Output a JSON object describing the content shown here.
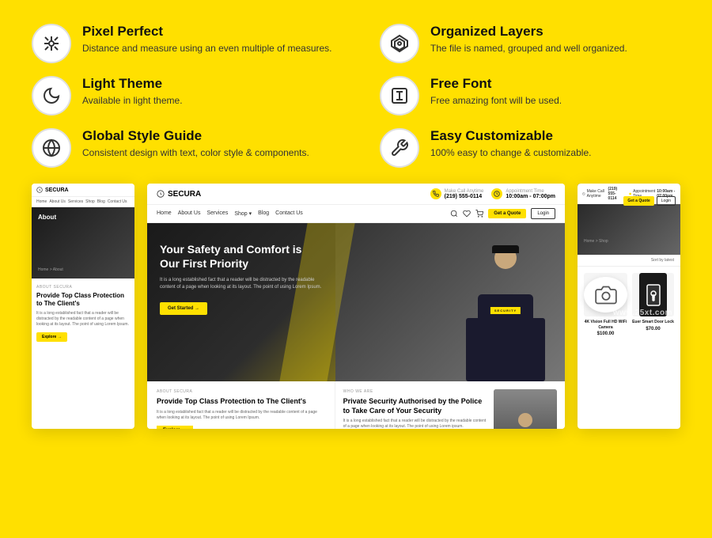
{
  "features": [
    {
      "id": "pixel-perfect",
      "title": "Pixel Perfect",
      "description": "Distance and measure using an even multiple of measures.",
      "icon": "⊕"
    },
    {
      "id": "organized-layers",
      "title": "Organized Layers",
      "description": "The file is named, grouped and well organized.",
      "icon": "◈"
    },
    {
      "id": "light-theme",
      "title": "Light Theme",
      "description": "Available in light theme.",
      "icon": "☾"
    },
    {
      "id": "free-font",
      "title": "Free Font",
      "description": "Free amazing font will be used.",
      "icon": "T"
    },
    {
      "id": "global-style",
      "title": "Global Style Guide",
      "description": "Consistent design with text, color style & components.",
      "icon": "⊕"
    },
    {
      "id": "easy-customizable",
      "title": "Easy Customizable",
      "description": "100% easy to change & customizable.",
      "icon": "✕"
    }
  ],
  "preview": {
    "brand_name": "SECURA",
    "contact_phone_label": "Make Call Anytime",
    "contact_phone": "(219) 555-0114",
    "contact_time_label": "Appointment Time",
    "contact_time": "10:00am - 07:00pm",
    "nav_links": [
      "Home",
      "About Us",
      "Services",
      "Shop",
      "Blog",
      "Contact Us"
    ],
    "cta_button": "Get a Quote",
    "login_button": "Login",
    "hero_title": "Your Safety and Comfort is Our First Priority",
    "hero_text": "It is a long established fact that a reader will be distracted by the readable content of a page when looking at its layout. The point of using Lorem Ipsum.",
    "hero_btn": "Get Started →",
    "about_label": "ABOUT SECURA",
    "about_title": "Provide Top Class Protection to The Client's",
    "about_text": "It is a long established fact that a reader will be distracted by the readable content of a page when looking at its layout. The point of using Lorem Ipsum.",
    "about_btn": "Explore →",
    "who_label": "WHO WE ARE",
    "who_title": "Private Security Authorised by the Police to Take Care of Your Security",
    "who_text": "It is a long established fact that a reader will be distracted by the readable content of a page when looking at its layout. The point of using Lorem ipsum.",
    "shop_breadcrumb": "Home > Shop",
    "shop_sort": "Sort by latest",
    "products": [
      {
        "name": "4K Vision Full HD WiFi Camera",
        "price": "$100.00"
      },
      {
        "name": "Euer Smart Door Lock",
        "price": "$70.00"
      }
    ],
    "side_left_breadcrumb": "Home > About",
    "side_right_breadcrumb": "Home > Shop"
  },
  "watermark": "www.25xt.com"
}
